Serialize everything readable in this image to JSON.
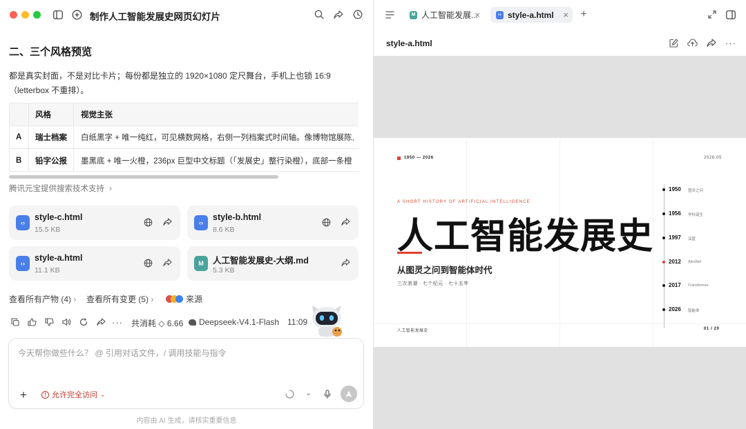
{
  "left": {
    "title": "制作人工智能发展史网页幻灯片",
    "heading": "二、三个风格预览",
    "para_line1": "都是真实封面，不是对比卡片；每份都是独立的 1920×1080 定尺舞台，手机上也锁 16:9",
    "para_line2": "（letterbox 不重排）。",
    "table": {
      "headers": [
        "风格",
        "视觉主张"
      ],
      "rows": [
        {
          "key": "A",
          "style": "瑞士档案",
          "desc": "白纸黑字 + 唯一纯红，可见横数网格，右侧一列档案式时间轴。像博物馆展陈,"
        },
        {
          "key": "B",
          "style": "铅字公报",
          "desc": "墨黑底 + 唯一火橙，236px 巨型中文标题（「发展史」整行染橙），底部一条橙"
        }
      ]
    },
    "source_note": "腾讯元宝提供搜索技术支持",
    "files": [
      {
        "name": "style-c.html",
        "size": "15.5 KB"
      },
      {
        "name": "style-b.html",
        "size": "8.6 KB"
      },
      {
        "name": "style-a.html",
        "size": "11.1 KB"
      },
      {
        "name": "人工智能发展史-大纲.md",
        "size": "5.3 KB"
      }
    ],
    "links": {
      "all_artifacts": "查看所有产物 (4)",
      "all_changes": "查看所有变更 (5)",
      "source": "来源"
    },
    "meta": {
      "cost": "共消耗 ◇ 6.66",
      "model": "Deepseek-V4.1-Flash",
      "time": "11:09"
    },
    "input": {
      "placeholder": "今天帮你做些什么？ @ 引用对话文件，/ 调用技能与指令",
      "permission": "允许完全访问"
    },
    "footer": "内容由 AI 生成，请核实重要信息"
  },
  "right": {
    "tabs": [
      {
        "label": "人工智能发展..."
      },
      {
        "label": "style-a.html"
      }
    ],
    "doc_title": "style-a.html",
    "slide": {
      "range": "1950 — 2026",
      "date": "2026.05",
      "kicker": "A SHORT HISTORY OF ARTIFICIAL INTELLIGENCE",
      "title": "人工智能发展史",
      "subtitle": "从图灵之问到智能体时代",
      "tagline": "三次浪潮 · 七个纪元 · 七十五年",
      "footer_left": "人工智能发展史",
      "page": "01 / 20",
      "timeline": [
        {
          "year": "1950",
          "label": "图灵之问",
          "highlight": false
        },
        {
          "year": "1956",
          "label": "学科诞生",
          "highlight": false
        },
        {
          "year": "1997",
          "label": "深蓝",
          "highlight": false
        },
        {
          "year": "2012",
          "label": "AlexNet",
          "highlight": true
        },
        {
          "year": "2017",
          "label": "Transformer",
          "highlight": false
        },
        {
          "year": "2026",
          "label": "智能体",
          "highlight": false
        }
      ]
    }
  },
  "colors": {
    "accent_red": "#e0412b",
    "file_html_blue": "#4a7ee8",
    "file_md_teal": "#4aa39b",
    "warning_red": "#c23b2f"
  }
}
